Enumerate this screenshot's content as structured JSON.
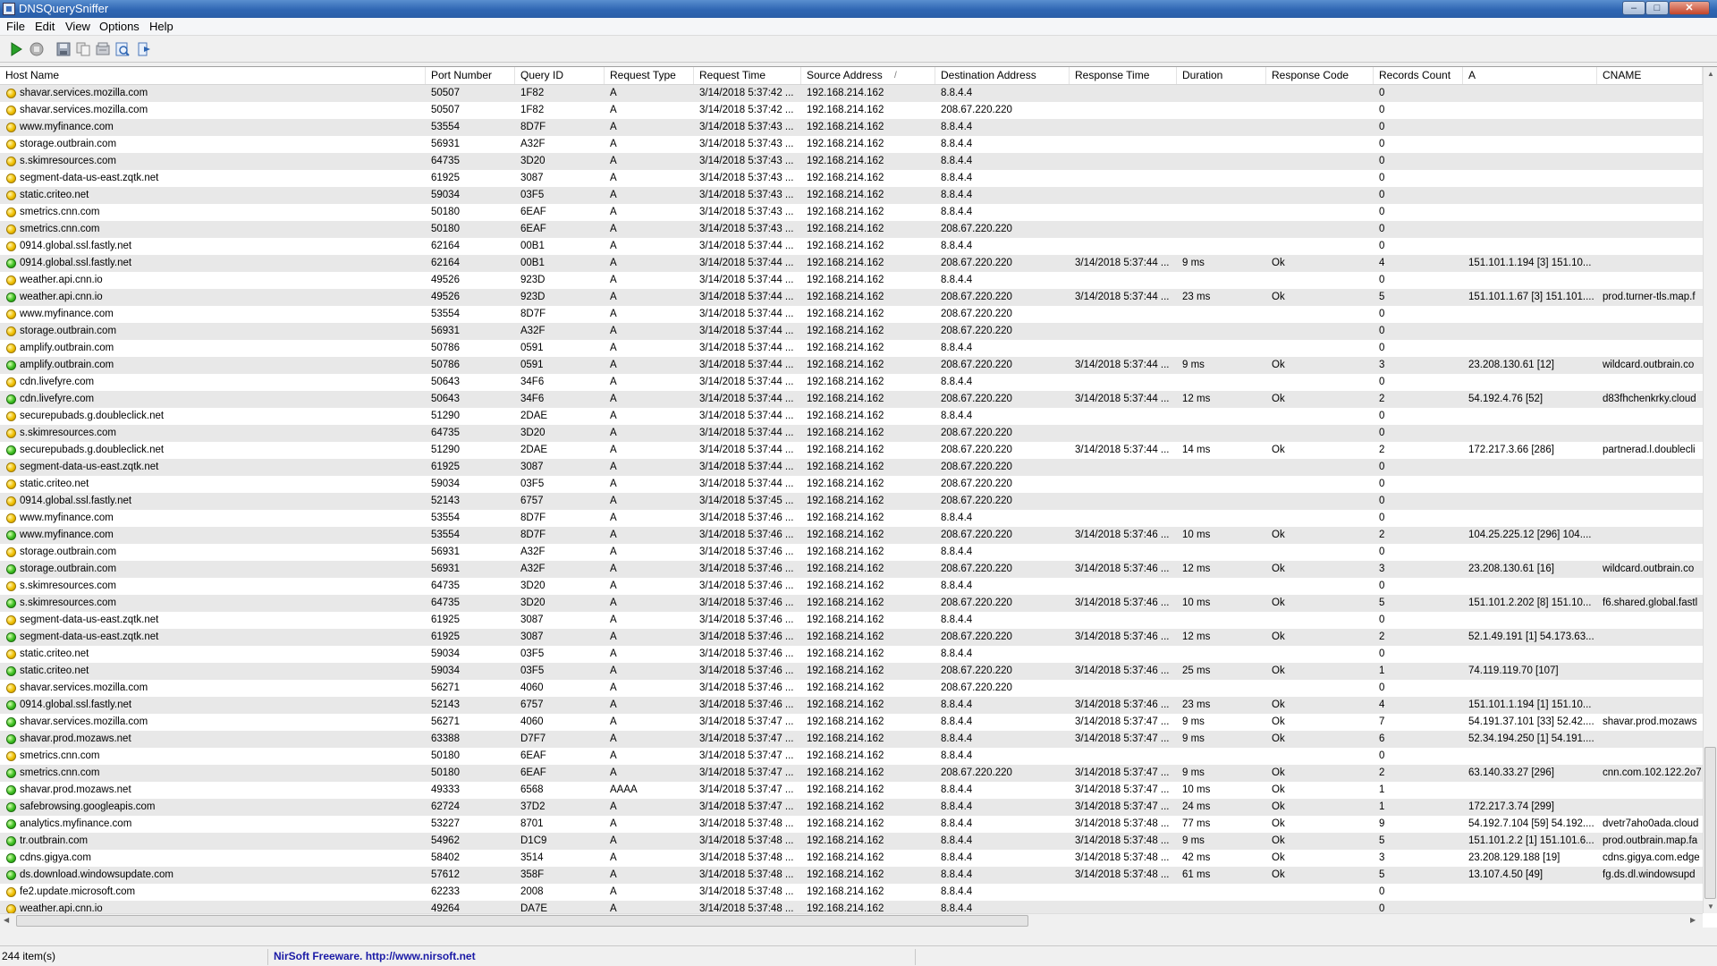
{
  "window": {
    "title": "DNSQuerySniffer"
  },
  "menu": [
    "File",
    "Edit",
    "View",
    "Options",
    "Help"
  ],
  "columns": [
    "Host Name",
    "Port Number",
    "Query ID",
    "Request Type",
    "Request Time",
    "Source Address",
    "Destination Address",
    "Response Time",
    "Duration",
    "Response Code",
    "Records Count",
    "A",
    "CNAME"
  ],
  "sort_indicator": "/",
  "colors": {
    "yellow_status": "#f0c000",
    "green_status": "#3cbf20",
    "title_bar": "#2f66b3",
    "link": "#1a1aa6"
  },
  "rows": [
    [
      "y",
      "shavar.services.mozilla.com",
      "50507",
      "1F82",
      "A",
      "3/14/2018 5:37:42 ...",
      "192.168.214.162",
      "8.8.4.4",
      "",
      "",
      "",
      "0",
      "",
      ""
    ],
    [
      "y",
      "shavar.services.mozilla.com",
      "50507",
      "1F82",
      "A",
      "3/14/2018 5:37:42 ...",
      "192.168.214.162",
      "208.67.220.220",
      "",
      "",
      "",
      "0",
      "",
      ""
    ],
    [
      "y",
      "www.myfinance.com",
      "53554",
      "8D7F",
      "A",
      "3/14/2018 5:37:43 ...",
      "192.168.214.162",
      "8.8.4.4",
      "",
      "",
      "",
      "0",
      "",
      ""
    ],
    [
      "y",
      "storage.outbrain.com",
      "56931",
      "A32F",
      "A",
      "3/14/2018 5:37:43 ...",
      "192.168.214.162",
      "8.8.4.4",
      "",
      "",
      "",
      "0",
      "",
      ""
    ],
    [
      "y",
      "s.skimresources.com",
      "64735",
      "3D20",
      "A",
      "3/14/2018 5:37:43 ...",
      "192.168.214.162",
      "8.8.4.4",
      "",
      "",
      "",
      "0",
      "",
      ""
    ],
    [
      "y",
      "segment-data-us-east.zqtk.net",
      "61925",
      "3087",
      "A",
      "3/14/2018 5:37:43 ...",
      "192.168.214.162",
      "8.8.4.4",
      "",
      "",
      "",
      "0",
      "",
      ""
    ],
    [
      "y",
      "static.criteo.net",
      "59034",
      "03F5",
      "A",
      "3/14/2018 5:37:43 ...",
      "192.168.214.162",
      "8.8.4.4",
      "",
      "",
      "",
      "0",
      "",
      ""
    ],
    [
      "y",
      "smetrics.cnn.com",
      "50180",
      "6EAF",
      "A",
      "3/14/2018 5:37:43 ...",
      "192.168.214.162",
      "8.8.4.4",
      "",
      "",
      "",
      "0",
      "",
      ""
    ],
    [
      "y",
      "smetrics.cnn.com",
      "50180",
      "6EAF",
      "A",
      "3/14/2018 5:37:43 ...",
      "192.168.214.162",
      "208.67.220.220",
      "",
      "",
      "",
      "0",
      "",
      ""
    ],
    [
      "y",
      "0914.global.ssl.fastly.net",
      "62164",
      "00B1",
      "A",
      "3/14/2018 5:37:44 ...",
      "192.168.214.162",
      "8.8.4.4",
      "",
      "",
      "",
      "0",
      "",
      ""
    ],
    [
      "g",
      "0914.global.ssl.fastly.net",
      "62164",
      "00B1",
      "A",
      "3/14/2018 5:37:44 ...",
      "192.168.214.162",
      "208.67.220.220",
      "3/14/2018 5:37:44 ...",
      "9 ms",
      "Ok",
      "4",
      "151.101.1.194 [3] 151.10...",
      ""
    ],
    [
      "y",
      "weather.api.cnn.io",
      "49526",
      "923D",
      "A",
      "3/14/2018 5:37:44 ...",
      "192.168.214.162",
      "8.8.4.4",
      "",
      "",
      "",
      "0",
      "",
      ""
    ],
    [
      "g",
      "weather.api.cnn.io",
      "49526",
      "923D",
      "A",
      "3/14/2018 5:37:44 ...",
      "192.168.214.162",
      "208.67.220.220",
      "3/14/2018 5:37:44 ...",
      "23 ms",
      "Ok",
      "5",
      "151.101.1.67 [3] 151.101....",
      "prod.turner-tls.map.f"
    ],
    [
      "y",
      "www.myfinance.com",
      "53554",
      "8D7F",
      "A",
      "3/14/2018 5:37:44 ...",
      "192.168.214.162",
      "208.67.220.220",
      "",
      "",
      "",
      "0",
      "",
      ""
    ],
    [
      "y",
      "storage.outbrain.com",
      "56931",
      "A32F",
      "A",
      "3/14/2018 5:37:44 ...",
      "192.168.214.162",
      "208.67.220.220",
      "",
      "",
      "",
      "0",
      "",
      ""
    ],
    [
      "y",
      "amplify.outbrain.com",
      "50786",
      "0591",
      "A",
      "3/14/2018 5:37:44 ...",
      "192.168.214.162",
      "8.8.4.4",
      "",
      "",
      "",
      "0",
      "",
      ""
    ],
    [
      "g",
      "amplify.outbrain.com",
      "50786",
      "0591",
      "A",
      "3/14/2018 5:37:44 ...",
      "192.168.214.162",
      "208.67.220.220",
      "3/14/2018 5:37:44 ...",
      "9 ms",
      "Ok",
      "3",
      "23.208.130.61 [12]",
      "wildcard.outbrain.co"
    ],
    [
      "y",
      "cdn.livefyre.com",
      "50643",
      "34F6",
      "A",
      "3/14/2018 5:37:44 ...",
      "192.168.214.162",
      "8.8.4.4",
      "",
      "",
      "",
      "0",
      "",
      ""
    ],
    [
      "g",
      "cdn.livefyre.com",
      "50643",
      "34F6",
      "A",
      "3/14/2018 5:37:44 ...",
      "192.168.214.162",
      "208.67.220.220",
      "3/14/2018 5:37:44 ...",
      "12 ms",
      "Ok",
      "2",
      "54.192.4.76 [52]",
      "d83fhchenkrky.cloud"
    ],
    [
      "y",
      "securepubads.g.doubleclick.net",
      "51290",
      "2DAE",
      "A",
      "3/14/2018 5:37:44 ...",
      "192.168.214.162",
      "8.8.4.4",
      "",
      "",
      "",
      "0",
      "",
      ""
    ],
    [
      "y",
      "s.skimresources.com",
      "64735",
      "3D20",
      "A",
      "3/14/2018 5:37:44 ...",
      "192.168.214.162",
      "208.67.220.220",
      "",
      "",
      "",
      "0",
      "",
      ""
    ],
    [
      "g",
      "securepubads.g.doubleclick.net",
      "51290",
      "2DAE",
      "A",
      "3/14/2018 5:37:44 ...",
      "192.168.214.162",
      "208.67.220.220",
      "3/14/2018 5:37:44 ...",
      "14 ms",
      "Ok",
      "2",
      "172.217.3.66 [286]",
      "partnerad.l.doublecli"
    ],
    [
      "y",
      "segment-data-us-east.zqtk.net",
      "61925",
      "3087",
      "A",
      "3/14/2018 5:37:44 ...",
      "192.168.214.162",
      "208.67.220.220",
      "",
      "",
      "",
      "0",
      "",
      ""
    ],
    [
      "y",
      "static.criteo.net",
      "59034",
      "03F5",
      "A",
      "3/14/2018 5:37:44 ...",
      "192.168.214.162",
      "208.67.220.220",
      "",
      "",
      "",
      "0",
      "",
      ""
    ],
    [
      "y",
      "0914.global.ssl.fastly.net",
      "52143",
      "6757",
      "A",
      "3/14/2018 5:37:45 ...",
      "192.168.214.162",
      "208.67.220.220",
      "",
      "",
      "",
      "0",
      "",
      ""
    ],
    [
      "y",
      "www.myfinance.com",
      "53554",
      "8D7F",
      "A",
      "3/14/2018 5:37:46 ...",
      "192.168.214.162",
      "8.8.4.4",
      "",
      "",
      "",
      "0",
      "",
      ""
    ],
    [
      "g",
      "www.myfinance.com",
      "53554",
      "8D7F",
      "A",
      "3/14/2018 5:37:46 ...",
      "192.168.214.162",
      "208.67.220.220",
      "3/14/2018 5:37:46 ...",
      "10 ms",
      "Ok",
      "2",
      "104.25.225.12 [296] 104....",
      ""
    ],
    [
      "y",
      "storage.outbrain.com",
      "56931",
      "A32F",
      "A",
      "3/14/2018 5:37:46 ...",
      "192.168.214.162",
      "8.8.4.4",
      "",
      "",
      "",
      "0",
      "",
      ""
    ],
    [
      "g",
      "storage.outbrain.com",
      "56931",
      "A32F",
      "A",
      "3/14/2018 5:37:46 ...",
      "192.168.214.162",
      "208.67.220.220",
      "3/14/2018 5:37:46 ...",
      "12 ms",
      "Ok",
      "3",
      "23.208.130.61 [16]",
      "wildcard.outbrain.co"
    ],
    [
      "y",
      "s.skimresources.com",
      "64735",
      "3D20",
      "A",
      "3/14/2018 5:37:46 ...",
      "192.168.214.162",
      "8.8.4.4",
      "",
      "",
      "",
      "0",
      "",
      ""
    ],
    [
      "g",
      "s.skimresources.com",
      "64735",
      "3D20",
      "A",
      "3/14/2018 5:37:46 ...",
      "192.168.214.162",
      "208.67.220.220",
      "3/14/2018 5:37:46 ...",
      "10 ms",
      "Ok",
      "5",
      "151.101.2.202 [8] 151.10...",
      "f6.shared.global.fastl"
    ],
    [
      "y",
      "segment-data-us-east.zqtk.net",
      "61925",
      "3087",
      "A",
      "3/14/2018 5:37:46 ...",
      "192.168.214.162",
      "8.8.4.4",
      "",
      "",
      "",
      "0",
      "",
      ""
    ],
    [
      "g",
      "segment-data-us-east.zqtk.net",
      "61925",
      "3087",
      "A",
      "3/14/2018 5:37:46 ...",
      "192.168.214.162",
      "208.67.220.220",
      "3/14/2018 5:37:46 ...",
      "12 ms",
      "Ok",
      "2",
      "52.1.49.191 [1] 54.173.63...",
      ""
    ],
    [
      "y",
      "static.criteo.net",
      "59034",
      "03F5",
      "A",
      "3/14/2018 5:37:46 ...",
      "192.168.214.162",
      "8.8.4.4",
      "",
      "",
      "",
      "0",
      "",
      ""
    ],
    [
      "g",
      "static.criteo.net",
      "59034",
      "03F5",
      "A",
      "3/14/2018 5:37:46 ...",
      "192.168.214.162",
      "208.67.220.220",
      "3/14/2018 5:37:46 ...",
      "25 ms",
      "Ok",
      "1",
      "74.119.119.70 [107]",
      ""
    ],
    [
      "y",
      "shavar.services.mozilla.com",
      "56271",
      "4060",
      "A",
      "3/14/2018 5:37:46 ...",
      "192.168.214.162",
      "208.67.220.220",
      "",
      "",
      "",
      "0",
      "",
      ""
    ],
    [
      "g",
      "0914.global.ssl.fastly.net",
      "52143",
      "6757",
      "A",
      "3/14/2018 5:37:46 ...",
      "192.168.214.162",
      "8.8.4.4",
      "3/14/2018 5:37:46 ...",
      "23 ms",
      "Ok",
      "4",
      "151.101.1.194 [1] 151.10...",
      ""
    ],
    [
      "g",
      "shavar.services.mozilla.com",
      "56271",
      "4060",
      "A",
      "3/14/2018 5:37:47 ...",
      "192.168.214.162",
      "8.8.4.4",
      "3/14/2018 5:37:47 ...",
      "9 ms",
      "Ok",
      "7",
      "54.191.37.101 [33] 52.42....",
      "shavar.prod.mozaws"
    ],
    [
      "g",
      "shavar.prod.mozaws.net",
      "63388",
      "D7F7",
      "A",
      "3/14/2018 5:37:47 ...",
      "192.168.214.162",
      "8.8.4.4",
      "3/14/2018 5:37:47 ...",
      "9 ms",
      "Ok",
      "6",
      "52.34.194.250 [1] 54.191....",
      ""
    ],
    [
      "y",
      "smetrics.cnn.com",
      "50180",
      "6EAF",
      "A",
      "3/14/2018 5:37:47 ...",
      "192.168.214.162",
      "8.8.4.4",
      "",
      "",
      "",
      "0",
      "",
      ""
    ],
    [
      "g",
      "smetrics.cnn.com",
      "50180",
      "6EAF",
      "A",
      "3/14/2018 5:37:47 ...",
      "192.168.214.162",
      "208.67.220.220",
      "3/14/2018 5:37:47 ...",
      "9 ms",
      "Ok",
      "2",
      "63.140.33.27 [296]",
      "cnn.com.102.122.2o7"
    ],
    [
      "g",
      "shavar.prod.mozaws.net",
      "49333",
      "6568",
      "AAAA",
      "3/14/2018 5:37:47 ...",
      "192.168.214.162",
      "8.8.4.4",
      "3/14/2018 5:37:47 ...",
      "10 ms",
      "Ok",
      "1",
      "",
      ""
    ],
    [
      "g",
      "safebrowsing.googleapis.com",
      "62724",
      "37D2",
      "A",
      "3/14/2018 5:37:47 ...",
      "192.168.214.162",
      "8.8.4.4",
      "3/14/2018 5:37:47 ...",
      "24 ms",
      "Ok",
      "1",
      "172.217.3.74 [299]",
      ""
    ],
    [
      "g",
      "analytics.myfinance.com",
      "53227",
      "8701",
      "A",
      "3/14/2018 5:37:48 ...",
      "192.168.214.162",
      "8.8.4.4",
      "3/14/2018 5:37:48 ...",
      "77 ms",
      "Ok",
      "9",
      "54.192.7.104 [59] 54.192....",
      "dvetr7aho0ada.cloud"
    ],
    [
      "g",
      "tr.outbrain.com",
      "54962",
      "D1C9",
      "A",
      "3/14/2018 5:37:48 ...",
      "192.168.214.162",
      "8.8.4.4",
      "3/14/2018 5:37:48 ...",
      "9 ms",
      "Ok",
      "5",
      "151.101.2.2 [1] 151.101.6...",
      "prod.outbrain.map.fa"
    ],
    [
      "g",
      "cdns.gigya.com",
      "58402",
      "3514",
      "A",
      "3/14/2018 5:37:48 ...",
      "192.168.214.162",
      "8.8.4.4",
      "3/14/2018 5:37:48 ...",
      "42 ms",
      "Ok",
      "3",
      "23.208.129.188 [19]",
      "cdns.gigya.com.edge"
    ],
    [
      "g",
      "ds.download.windowsupdate.com",
      "57612",
      "358F",
      "A",
      "3/14/2018 5:37:48 ...",
      "192.168.214.162",
      "8.8.4.4",
      "3/14/2018 5:37:48 ...",
      "61 ms",
      "Ok",
      "5",
      "13.107.4.50 [49]",
      "fg.ds.dl.windowsupd"
    ],
    [
      "y",
      "fe2.update.microsoft.com",
      "62233",
      "2008",
      "A",
      "3/14/2018 5:37:48 ...",
      "192.168.214.162",
      "8.8.4.4",
      "",
      "",
      "",
      "0",
      "",
      ""
    ],
    [
      "y",
      "weather.api.cnn.io",
      "49264",
      "DA7E",
      "A",
      "3/14/2018 5:37:48 ...",
      "192.168.214.162",
      "8.8.4.4",
      "",
      "",
      "",
      "0",
      "",
      ""
    ]
  ],
  "status": {
    "count": "244 item(s)",
    "link_text": "NirSoft Freeware.  http://www.nirsoft.net"
  }
}
